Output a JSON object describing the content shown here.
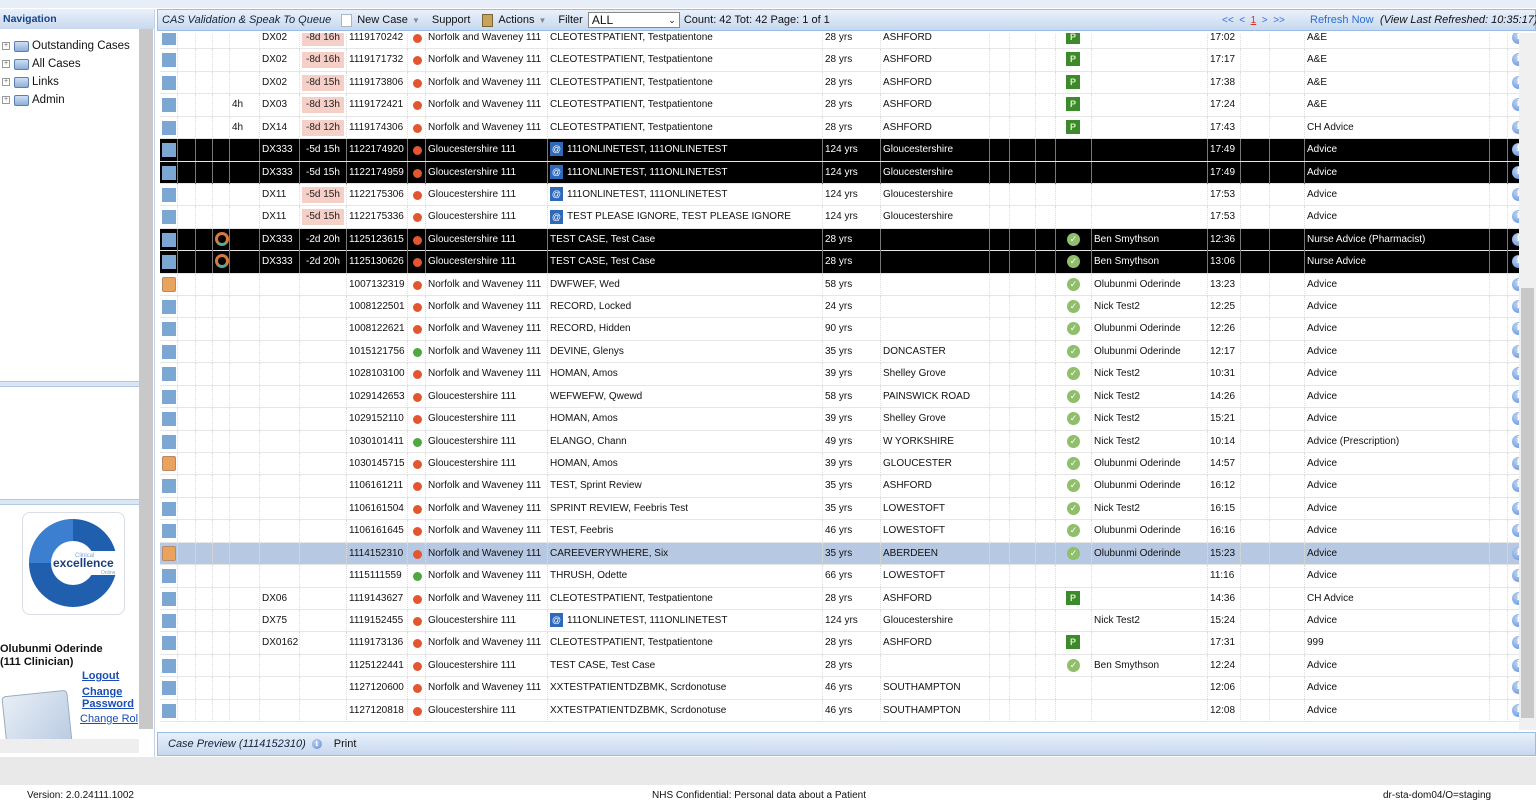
{
  "nav": {
    "title": "Navigation",
    "items": [
      "Outstanding Cases",
      "All Cases",
      "Links",
      "Admin"
    ]
  },
  "logo": {
    "small_top": "Clinical",
    "main": "excellence",
    "small_bottom": "Online"
  },
  "user": {
    "name": "Olubunmi Oderinde",
    "role": "(111 Clinician)",
    "logout": "Logout",
    "change_password_1": "Change",
    "change_password_2": "Password",
    "change_role": "Change Role"
  },
  "toolbar": {
    "title": "CAS Validation & Speak To Queue",
    "new_case": "New Case",
    "support": "Support",
    "actions": "Actions",
    "filter_label": "Filter",
    "filter_value": "ALL",
    "counts": "Count: 42 Tot: 42 Page: 1 of 1",
    "pager": {
      "first": "<<",
      "prev": "<",
      "current": "1",
      "next": ">",
      "last": ">>"
    },
    "refresh": "Refresh Now",
    "last_refreshed": "(View Last Refreshed: 10:35:17)"
  },
  "colors": {
    "red_dot": "#e2572f",
    "green_dot": "#4fa83d",
    "row_selected": "#b7c9e2",
    "badge": "#f6cfc6"
  },
  "rows": [
    {
      "c5": "",
      "dx": "DX02",
      "due": "-8d 16h",
      "id": "1119170242",
      "dot": "red",
      "svc": "Norfolk and Waveney 111",
      "name": "CLEOTESTPATIENT, Testpatientone",
      "age": "28 yrs",
      "place": "ASHFORD",
      "status": "P",
      "clin": "",
      "time": "17:02",
      "type": "A&E"
    },
    {
      "c5": "",
      "dx": "DX02",
      "due": "-8d 16h",
      "id": "1119171732",
      "dot": "red",
      "svc": "Norfolk and Waveney 111",
      "name": "CLEOTESTPATIENT, Testpatientone",
      "age": "28 yrs",
      "place": "ASHFORD",
      "status": "P",
      "clin": "",
      "time": "17:17",
      "type": "A&E"
    },
    {
      "c5": "",
      "dx": "DX02",
      "due": "-8d 15h",
      "id": "1119173806",
      "dot": "red",
      "svc": "Norfolk and Waveney 111",
      "name": "CLEOTESTPATIENT, Testpatientone",
      "age": "28 yrs",
      "place": "ASHFORD",
      "status": "P",
      "clin": "",
      "time": "17:38",
      "type": "A&E"
    },
    {
      "c5": "4h",
      "dx": "DX03",
      "due": "-8d 13h",
      "id": "1119172421",
      "dot": "red",
      "svc": "Norfolk and Waveney 111",
      "name": "CLEOTESTPATIENT, Testpatientone",
      "age": "28 yrs",
      "place": "ASHFORD",
      "status": "P",
      "clin": "",
      "time": "17:24",
      "type": "A&E"
    },
    {
      "c5": "4h",
      "dx": "DX14",
      "due": "-8d 12h",
      "id": "1119174306",
      "dot": "red",
      "svc": "Norfolk and Waveney 111",
      "name": "CLEOTESTPATIENT, Testpatientone",
      "age": "28 yrs",
      "place": "ASHFORD",
      "status": "P",
      "clin": "",
      "time": "17:43",
      "type": "CH Advice"
    },
    {
      "style": "black",
      "dx": "DX333",
      "due": "-5d 15h",
      "id": "1122174920",
      "dot": "red",
      "svc": "Gloucestershire 111",
      "online": true,
      "name": "111ONLINETEST, 111ONLINETEST",
      "age": "124 yrs",
      "place": "Gloucestershire",
      "status": "",
      "clin": "",
      "time": "17:49",
      "type": "Advice"
    },
    {
      "style": "black",
      "dx": "DX333",
      "due": "-5d 15h",
      "id": "1122174959",
      "dot": "red",
      "svc": "Gloucestershire 111",
      "online": true,
      "name": "111ONLINETEST, 111ONLINETEST",
      "age": "124 yrs",
      "place": "Gloucestershire",
      "status": "",
      "clin": "",
      "time": "17:49",
      "type": "Advice"
    },
    {
      "dx": "DX11",
      "due": "-5d 15h",
      "id": "1122175306",
      "dot": "red",
      "svc": "Gloucestershire 111",
      "online": true,
      "name": "111ONLINETEST, 111ONLINETEST",
      "age": "124 yrs",
      "place": "Gloucestershire",
      "status": "",
      "clin": "",
      "time": "17:53",
      "type": "Advice"
    },
    {
      "dx": "DX11",
      "due": "-5d 15h",
      "id": "1122175336",
      "dot": "red",
      "svc": "Gloucestershire 111",
      "online": true,
      "name": "TEST PLEASE IGNORE, TEST PLEASE IGNORE",
      "age": "124 yrs",
      "place": "Gloucestershire",
      "status": "",
      "clin": "",
      "time": "17:53",
      "type": "Advice"
    },
    {
      "style": "black",
      "flag": "recall",
      "dx": "DX333",
      "due": "-2d 20h",
      "id": "1125123615",
      "dot": "red",
      "svc": "Gloucestershire 111",
      "name": "TEST CASE, Test Case",
      "age": "28 yrs",
      "place": "",
      "status": "check",
      "clin": "Ben Smythson",
      "time": "12:36",
      "type": "Nurse Advice (Pharmacist)"
    },
    {
      "style": "black",
      "flag": "recall",
      "dx": "DX333",
      "due": "-2d 20h",
      "id": "1125130626",
      "dot": "red",
      "svc": "Gloucestershire 111",
      "name": "TEST CASE, Test Case",
      "age": "28 yrs",
      "place": "",
      "status": "check",
      "clin": "Ben Smythson",
      "time": "13:06",
      "type": "Nurse Advice"
    },
    {
      "lock": true,
      "id": "1007132319",
      "dot": "red",
      "svc": "Norfolk and Waveney 111",
      "name": "DWFWEF, Wed",
      "age": "58 yrs",
      "place": "",
      "status": "check",
      "clin": "Olubunmi Oderinde",
      "time": "13:23",
      "type": "Advice"
    },
    {
      "id": "1008122501",
      "dot": "red",
      "svc": "Norfolk and Waveney 111",
      "name": "RECORD, Locked",
      "age": "24 yrs",
      "place": "",
      "status": "check",
      "clin": "Nick Test2",
      "time": "12:25",
      "type": "Advice"
    },
    {
      "id": "1008122621",
      "dot": "red",
      "svc": "Norfolk and Waveney 111",
      "name": "RECORD, Hidden",
      "age": "90 yrs",
      "place": "",
      "status": "check",
      "clin": "Olubunmi Oderinde",
      "time": "12:26",
      "type": "Advice"
    },
    {
      "id": "1015121756",
      "dot": "green",
      "svc": "Norfolk and Waveney 111",
      "name": "DEVINE, Glenys",
      "age": "35 yrs",
      "place": "DONCASTER",
      "status": "check",
      "clin": "Olubunmi Oderinde",
      "time": "12:17",
      "type": "Advice"
    },
    {
      "id": "1028103100",
      "dot": "red",
      "svc": "Norfolk and Waveney 111",
      "name": "HOMAN, Amos",
      "age": "39 yrs",
      "place": "Shelley Grove",
      "status": "check",
      "clin": "Nick Test2",
      "time": "10:31",
      "type": "Advice"
    },
    {
      "id": "1029142653",
      "dot": "red",
      "svc": "Gloucestershire 111",
      "name": "WEFWEFW, Qwewd",
      "age": "58 yrs",
      "place": "PAINSWICK ROAD",
      "status": "check",
      "clin": "Nick Test2",
      "time": "14:26",
      "type": "Advice"
    },
    {
      "id": "1029152110",
      "dot": "red",
      "svc": "Gloucestershire 111",
      "name": "HOMAN, Amos",
      "age": "39 yrs",
      "place": "Shelley Grove",
      "status": "check",
      "clin": "Nick Test2",
      "time": "15:21",
      "type": "Advice"
    },
    {
      "id": "1030101411",
      "dot": "green",
      "svc": "Gloucestershire 111",
      "name": "ELANGO, Chann",
      "age": "49 yrs",
      "place": "W YORKSHIRE",
      "status": "check",
      "clin": "Nick Test2",
      "time": "10:14",
      "type": "Advice (Prescription)"
    },
    {
      "lock": true,
      "id": "1030145715",
      "dot": "red",
      "svc": "Gloucestershire 111",
      "name": "HOMAN, Amos",
      "age": "39 yrs",
      "place": "GLOUCESTER",
      "status": "check",
      "clin": "Olubunmi Oderinde",
      "time": "14:57",
      "type": "Advice"
    },
    {
      "id": "1106161211",
      "dot": "red",
      "svc": "Norfolk and Waveney 111",
      "name": "TEST, Sprint Review",
      "age": "35 yrs",
      "place": "ASHFORD",
      "status": "check",
      "clin": "Olubunmi Oderinde",
      "time": "16:12",
      "type": "Advice"
    },
    {
      "id": "1106161504",
      "dot": "red",
      "svc": "Norfolk and Waveney 111",
      "name": "SPRINT REVIEW, Feebris Test",
      "age": "35 yrs",
      "place": "LOWESTOFT",
      "status": "check",
      "clin": "Nick Test2",
      "time": "16:15",
      "type": "Advice"
    },
    {
      "id": "1106161645",
      "dot": "red",
      "svc": "Norfolk and Waveney 111",
      "name": "TEST, Feebris",
      "age": "46 yrs",
      "place": "LOWESTOFT",
      "status": "check",
      "clin": "Olubunmi Oderinde",
      "time": "16:16",
      "type": "Advice"
    },
    {
      "style": "selected",
      "lock": true,
      "id": "1114152310",
      "dot": "red",
      "svc": "Norfolk and Waveney 111",
      "name": "CAREEVERYWHERE, Six",
      "age": "35 yrs",
      "place": "ABERDEEN",
      "status": "check",
      "clin": "Olubunmi Oderinde",
      "time": "15:23",
      "type": "Advice"
    },
    {
      "id": "1115111559",
      "dot": "green",
      "svc": "Norfolk and Waveney 111",
      "name": "THRUSH, Odette",
      "age": "66 yrs",
      "place": "LOWESTOFT",
      "status": "",
      "clin": "",
      "time": "11:16",
      "type": "Advice"
    },
    {
      "dx": "DX06",
      "id": "1119143627",
      "dot": "red",
      "svc": "Norfolk and Waveney 111",
      "name": "CLEOTESTPATIENT, Testpatientone",
      "age": "28 yrs",
      "place": "ASHFORD",
      "status": "P",
      "clin": "",
      "time": "14:36",
      "type": "CH Advice"
    },
    {
      "dx": "DX75",
      "id": "1119152455",
      "dot": "red",
      "svc": "Gloucestershire 111",
      "online": true,
      "name": "111ONLINETEST, 111ONLINETEST",
      "age": "124 yrs",
      "place": "Gloucestershire",
      "status": "",
      "clin": "Nick Test2",
      "time": "15:24",
      "type": "Advice"
    },
    {
      "dx": "DX0162",
      "id": "1119173136",
      "dot": "red",
      "svc": "Norfolk and Waveney 111",
      "name": "CLEOTESTPATIENT, Testpatientone",
      "age": "28 yrs",
      "place": "ASHFORD",
      "status": "P",
      "clin": "",
      "time": "17:31",
      "type": "999"
    },
    {
      "id": "1125122441",
      "dot": "red",
      "svc": "Gloucestershire 111",
      "name": "TEST CASE, Test Case",
      "age": "28 yrs",
      "place": "",
      "status": "check",
      "clin": "Ben Smythson",
      "time": "12:24",
      "type": "Advice"
    },
    {
      "id": "1127120600",
      "dot": "red",
      "svc": "Norfolk and Waveney 111",
      "name": "XXTESTPATIENTDZBMK, Scrdonotuse",
      "age": "46 yrs",
      "place": "SOUTHAMPTON",
      "status": "",
      "clin": "",
      "time": "12:06",
      "type": "Advice"
    },
    {
      "id": "1127120818",
      "dot": "red",
      "svc": "Gloucestershire 111",
      "name": "XXTESTPATIENTDZBMK, Scrdonotuse",
      "age": "46 yrs",
      "place": "SOUTHAMPTON",
      "status": "",
      "clin": "",
      "time": "12:08",
      "type": "Advice"
    }
  ],
  "preview": {
    "title": "Case Preview (1114152310)",
    "print": "Print"
  },
  "footer": {
    "version": "Version: 2.0.24111.1002",
    "confidential": "NHS Confidential: Personal data about a Patient",
    "server": "dr-sta-dom04/O=staging"
  }
}
